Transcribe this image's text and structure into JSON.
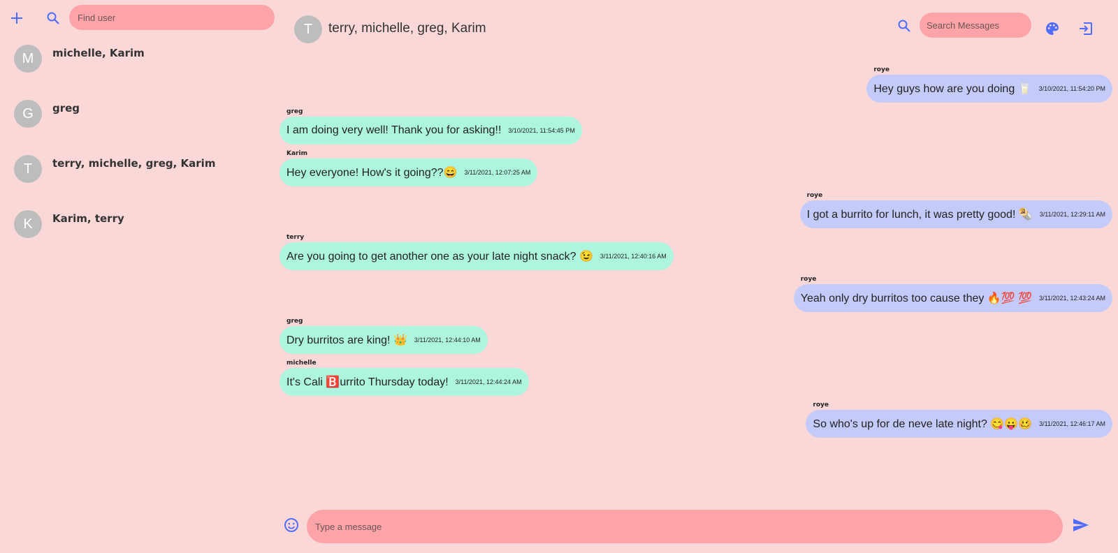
{
  "colors": {
    "background": "#fad8d8",
    "input_bg": "#fda4a8",
    "incoming_bubble": "#aef5df",
    "outgoing_bubble": "#c5cbf8",
    "icon_accent": "#4f6ef7",
    "avatar_bg": "#bdbdbd"
  },
  "sidebar": {
    "add_icon": "plus-icon",
    "search_icon": "search-icon",
    "find_placeholder": "Find user",
    "conversations": [
      {
        "initial": "M",
        "name": "michelle, Karim"
      },
      {
        "initial": "G",
        "name": "greg"
      },
      {
        "initial": "T",
        "name": "terry, michelle, greg, Karim"
      },
      {
        "initial": "K",
        "name": "Karim, terry"
      }
    ]
  },
  "header": {
    "initial": "T",
    "title": "terry, michelle, greg, Karim",
    "search_placeholder": "Search Messages",
    "search_icon": "search-icon",
    "palette_icon": "palette-icon",
    "logout_icon": "logout-icon"
  },
  "messages": [
    {
      "sender": "roye",
      "direction": "out",
      "text": "Hey guys how are you doing 🥛",
      "time": "3/10/2021, 11:54:20 PM"
    },
    {
      "sender": "greg",
      "direction": "in",
      "text": "I am doing very well! Thank you for asking!!",
      "time": "3/10/2021, 11:54:45 PM"
    },
    {
      "sender": "Karim",
      "direction": "in",
      "text": "Hey everyone! How's it going??😄",
      "time": "3/11/2021, 12:07:25 AM"
    },
    {
      "sender": "roye",
      "direction": "out",
      "text": "I got a burrito for lunch, it was pretty good! 🌯",
      "time": "3/11/2021, 12:29:11 AM"
    },
    {
      "sender": "terry",
      "direction": "in",
      "text": "Are you going to get another one as your late night snack? 😉",
      "time": "3/11/2021, 12:40:16 AM"
    },
    {
      "sender": "roye",
      "direction": "out",
      "text": "Yeah only dry burritos too cause they 🔥💯 💯",
      "time": "3/11/2021, 12:43:24 AM"
    },
    {
      "sender": "greg",
      "direction": "in",
      "text": "Dry burritos are king! 👑",
      "time": "3/11/2021, 12:44:10 AM"
    },
    {
      "sender": "michelle",
      "direction": "in",
      "text": "It's Cali 🅱️urrito Thursday today!",
      "time": "3/11/2021, 12:44:24 AM"
    },
    {
      "sender": "roye",
      "direction": "out",
      "text": "So who's up for de neve late night? 😋😛🥴",
      "time": "3/11/2021, 12:46:17 AM"
    }
  ],
  "footer": {
    "emoji_icon": "emoji-icon",
    "message_placeholder": "Type a message",
    "send_icon": "send-icon"
  }
}
